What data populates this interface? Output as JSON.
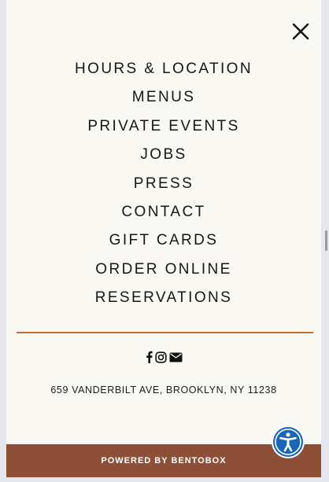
{
  "menu": {
    "close_icon": "close-icon",
    "items": [
      {
        "label": "HOURS & LOCATION"
      },
      {
        "label": "MENUS"
      },
      {
        "label": "PRIVATE EVENTS"
      },
      {
        "label": "JOBS"
      },
      {
        "label": "PRESS"
      },
      {
        "label": "CONTACT"
      },
      {
        "label": "GIFT CARDS"
      },
      {
        "label": "ORDER ONLINE"
      },
      {
        "label": "RESERVATIONS"
      }
    ]
  },
  "social": {
    "icons": [
      "facebook-icon",
      "instagram-icon",
      "email-icon"
    ]
  },
  "address": "659 VANDERBILT AVE, BROOKLYN, NY 11238",
  "footer": {
    "powered_by": "POWERED BY BENTOBOX"
  },
  "accessibility": {
    "icon": "accessibility-icon"
  },
  "colors": {
    "panel_bg": "#f9f8f3",
    "divider": "#c06d32",
    "footer_bg": "#8e4f38",
    "accessibility_blue": "#1b65b5",
    "text": "#161616"
  }
}
